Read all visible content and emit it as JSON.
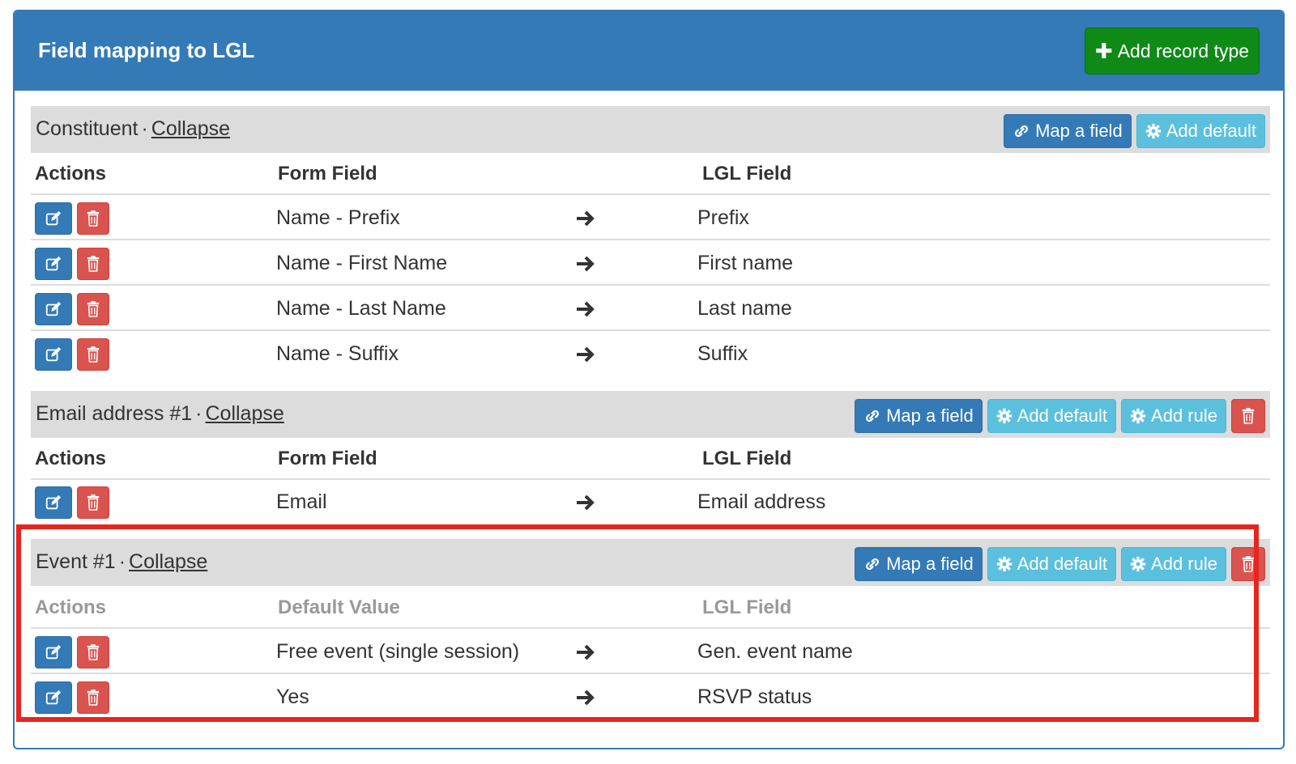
{
  "panel": {
    "title": "Field mapping to LGL",
    "add_record_type_label": "Add record type",
    "add_record_type_icon": "plus-icon",
    "header_color": "#337ab7"
  },
  "sections": [
    {
      "name": "Constituent",
      "separator": "·",
      "collapse_label": "Collapse",
      "buttons": {
        "map_field": "Map a field",
        "add_default": "Add default"
      },
      "columns": {
        "actions": "Actions",
        "source": "Form Field",
        "target": "LGL Field"
      },
      "rows": [
        {
          "source": "Name - Prefix",
          "target": "Prefix"
        },
        {
          "source": "Name - First Name",
          "target": "First name"
        },
        {
          "source": "Name - Last Name",
          "target": "Last name"
        },
        {
          "source": "Name - Suffix",
          "target": "Suffix"
        }
      ]
    },
    {
      "name": "Email address #1",
      "separator": "·",
      "collapse_label": "Collapse",
      "buttons": {
        "map_field": "Map a field",
        "add_default": "Add default",
        "add_rule": "Add rule"
      },
      "columns": {
        "actions": "Actions",
        "source": "Form Field",
        "target": "LGL Field"
      },
      "rows": [
        {
          "source": "Email",
          "target": "Email address"
        }
      ]
    },
    {
      "name": "Event #1",
      "separator": "·",
      "collapse_label": "Collapse",
      "buttons": {
        "map_field": "Map a field",
        "add_default": "Add default",
        "add_rule": "Add rule"
      },
      "columns": {
        "actions": "Actions",
        "source": "Default Value",
        "target": "LGL Field"
      },
      "rows": [
        {
          "source": "Free event (single session)",
          "target": "Gen. event name"
        },
        {
          "source": "Yes",
          "target": "RSVP status"
        }
      ]
    }
  ],
  "colors": {
    "primary": "#337ab7",
    "info": "#5bc0de",
    "danger": "#d9534f",
    "success": "#0f8a17",
    "highlight": "#e8251c"
  }
}
